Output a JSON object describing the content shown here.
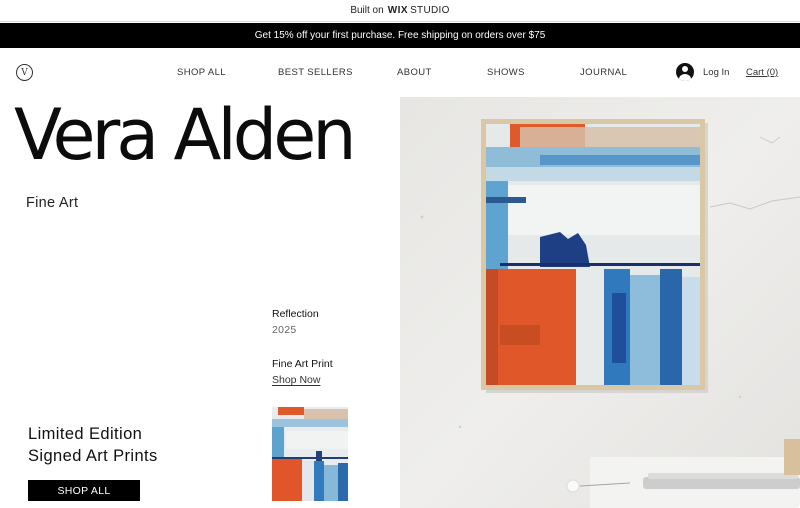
{
  "wix_bar": {
    "prefix": "Built on",
    "logo": "WIX",
    "product": "STUDIO"
  },
  "promo": {
    "text": "Get 15% off your first purchase. Free shipping on orders over $75"
  },
  "header": {
    "logo_letter": "V",
    "nav": [
      {
        "label": "SHOP ALL"
      },
      {
        "label": "BEST SELLERS"
      },
      {
        "label": "ABOUT"
      },
      {
        "label": "SHOWS"
      },
      {
        "label": "JOURNAL"
      }
    ],
    "login_label": "Log In",
    "cart_label": "Cart (0)",
    "icons": {
      "account": "user-avatar-icon",
      "logo": "v-circle-logo"
    }
  },
  "hero": {
    "title": "Vera Alden",
    "subtitle": "Fine Art",
    "artwork": {
      "name": "Reflection",
      "year": "2025",
      "type": "Fine Art Print",
      "link_label": "Shop Now"
    },
    "promo_heading_line1": "Limited Edition",
    "promo_heading_line2": "Signed Art Prints",
    "cta_label": "SHOP ALL"
  },
  "colors": {
    "promo_bg": "#000000",
    "accent_orange": "#e2562a",
    "accent_blue": "#2c6fb5",
    "wall": "#ececea"
  }
}
